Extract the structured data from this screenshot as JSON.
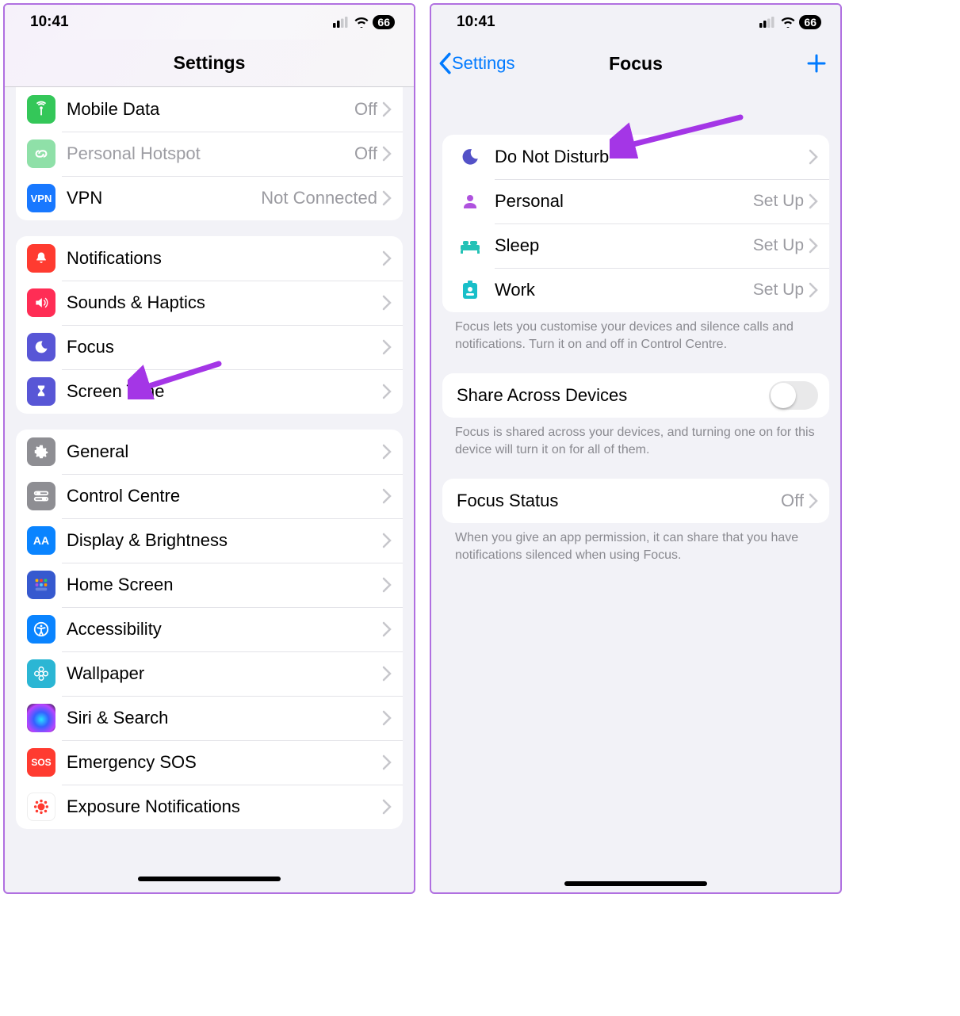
{
  "status": {
    "time": "10:41",
    "battery": "66"
  },
  "left": {
    "title": "Settings",
    "group1": [
      {
        "name": "mobile-data",
        "label": "Mobile Data",
        "value": "Off",
        "color": "#34c759",
        "disabled": false
      },
      {
        "name": "personal-hotspot",
        "label": "Personal Hotspot",
        "value": "Off",
        "color": "#7ed88f",
        "disabled": true
      },
      {
        "name": "vpn",
        "label": "VPN",
        "value": "Not Connected",
        "color": "#1a82ff",
        "disabled": false
      }
    ],
    "group2": [
      {
        "name": "notifications",
        "label": "Notifications",
        "color": "#ff3b30"
      },
      {
        "name": "sounds",
        "label": "Sounds & Haptics",
        "color": "#ff2d55"
      },
      {
        "name": "focus",
        "label": "Focus",
        "color": "#5856d6"
      },
      {
        "name": "screen-time",
        "label": "Screen Time",
        "color": "#5856d6"
      }
    ],
    "group3": [
      {
        "name": "general",
        "label": "General",
        "color": "#8e8e93"
      },
      {
        "name": "control-centre",
        "label": "Control Centre",
        "color": "#8e8e93"
      },
      {
        "name": "display",
        "label": "Display & Brightness",
        "color": "#0a84ff"
      },
      {
        "name": "home-screen",
        "label": "Home Screen",
        "color": "#3955b5"
      },
      {
        "name": "accessibility",
        "label": "Accessibility",
        "color": "#0a84ff"
      },
      {
        "name": "wallpaper",
        "label": "Wallpaper",
        "color": "#30b0c7"
      },
      {
        "name": "siri",
        "label": "Siri & Search",
        "color": "#1f1f1f"
      },
      {
        "name": "sos",
        "label": "Emergency SOS",
        "color": "#ff3b30"
      },
      {
        "name": "exposure",
        "label": "Exposure Notifications",
        "color": "#ffffff"
      }
    ]
  },
  "right": {
    "back": "Settings",
    "title": "Focus",
    "modes": [
      {
        "name": "dnd",
        "label": "Do Not Disturb",
        "value": "",
        "iconColor": "#5351c7"
      },
      {
        "name": "personal",
        "label": "Personal",
        "value": "Set Up",
        "iconColor": "#af52de"
      },
      {
        "name": "sleep",
        "label": "Sleep",
        "value": "Set Up",
        "iconColor": "#24c2b6"
      },
      {
        "name": "work",
        "label": "Work",
        "value": "Set Up",
        "iconColor": "#19bfc9"
      }
    ],
    "modes_footer": "Focus lets you customise your devices and silence calls and notifications. Turn it on and off in Control Centre.",
    "share": {
      "label": "Share Across Devices"
    },
    "share_footer": "Focus is shared across your devices, and turning one on for this device will turn it on for all of them.",
    "status_row": {
      "label": "Focus Status",
      "value": "Off"
    },
    "status_footer": "When you give an app permission, it can share that you have notifications silenced when using Focus."
  }
}
